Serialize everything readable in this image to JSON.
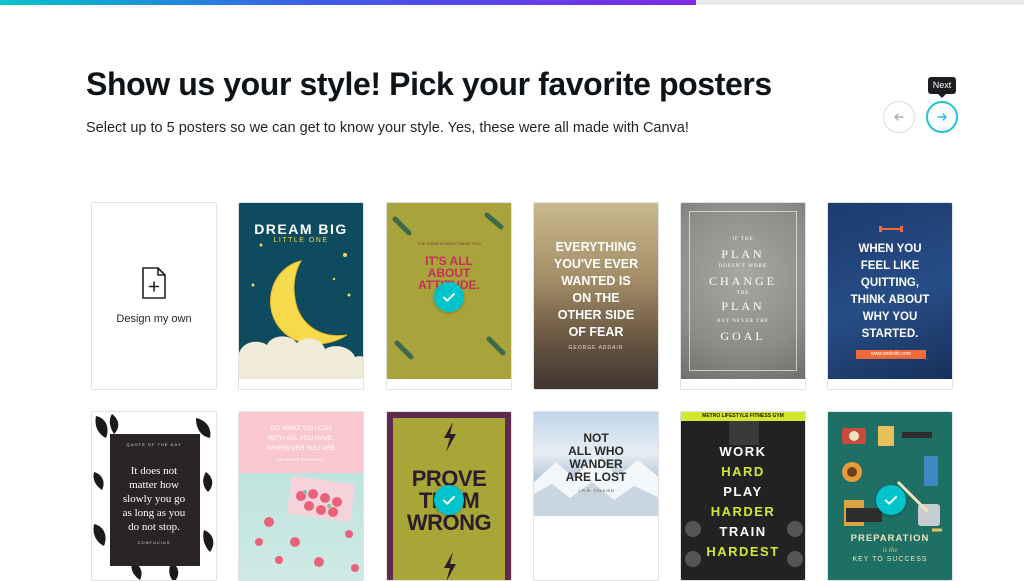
{
  "progress": {
    "fraction": 0.68,
    "fill_gradient": [
      "#00c4cc",
      "#3d5be6",
      "#7d2ae8"
    ]
  },
  "header": {
    "title": "Show us your style! Pick your favorite posters",
    "subtitle": "Select up to 5 posters so we can get to know your style. Yes, these were all made with Canva!"
  },
  "nav": {
    "next_tooltip": "Next",
    "prev_icon": "arrow-left-icon",
    "next_icon": "arrow-right-icon",
    "accent": "#22c3d6"
  },
  "design_own": {
    "label": "Design my own",
    "icon": "new-document-plus-icon"
  },
  "posters": {
    "dream_big": {
      "title": "DREAM BIG",
      "subtitle": "LITTLE ONE",
      "selected": false
    },
    "its_all_about": {
      "top": "THE THING IS ABOUT WHAT YOU",
      "lines": [
        "IT'S ALL",
        "ABOUT",
        "ATTITUDE."
      ],
      "selected": true
    },
    "everything": {
      "lines": [
        "EVERYTHING",
        "YOU'VE EVER",
        "WANTED IS",
        "ON THE",
        "OTHER SIDE",
        "OF FEAR"
      ],
      "author": "GEORGE ADDAIR",
      "selected": false
    },
    "plan": {
      "lines": [
        "IF THE",
        "PLAN",
        "DOESN'T WORK",
        "CHANGE",
        "THE",
        "PLAN",
        "BUT NEVER THE",
        "GOAL"
      ],
      "selected": false
    },
    "quitting": {
      "lines": [
        "WHEN YOU",
        "FEEL LIKE",
        "QUITTING,",
        "THINK ABOUT",
        "WHY YOU",
        "STARTED."
      ],
      "url": "www.website.com",
      "selected": false
    },
    "slowly": {
      "top": "QUOTE OF THE DAY",
      "lines": [
        "It does not",
        "matter how",
        "slowly you go",
        "as long as you",
        "do not stop."
      ],
      "author": "CONFUCIUS",
      "selected": false
    },
    "do_what": {
      "lines": [
        "DO WHAT YOU CAN",
        "WITH ALL YOU HAVE,",
        "WHEREVER YOU ARE"
      ],
      "author": "THEODORE ROOSEVELT",
      "selected": false
    },
    "prove": {
      "lines": [
        "PROVE",
        "THEM",
        "WRONG"
      ],
      "selected": true
    },
    "wander": {
      "lines": [
        "NOT",
        "ALL WHO",
        "WANDER",
        "ARE LOST"
      ],
      "author": "J.R.R. TOLKIEN",
      "selected": false
    },
    "work_hard": {
      "top": "METRO LIFESTYLE FITNESS GYM",
      "lines": [
        "WORK",
        "HARD",
        "PLAY",
        "HARDER",
        "TRAIN",
        "HARDEST"
      ],
      "selected": false
    },
    "preparation": {
      "lines": [
        "PREPARATION",
        "is the",
        "KEY TO SUCCESS"
      ],
      "selected": true
    }
  }
}
